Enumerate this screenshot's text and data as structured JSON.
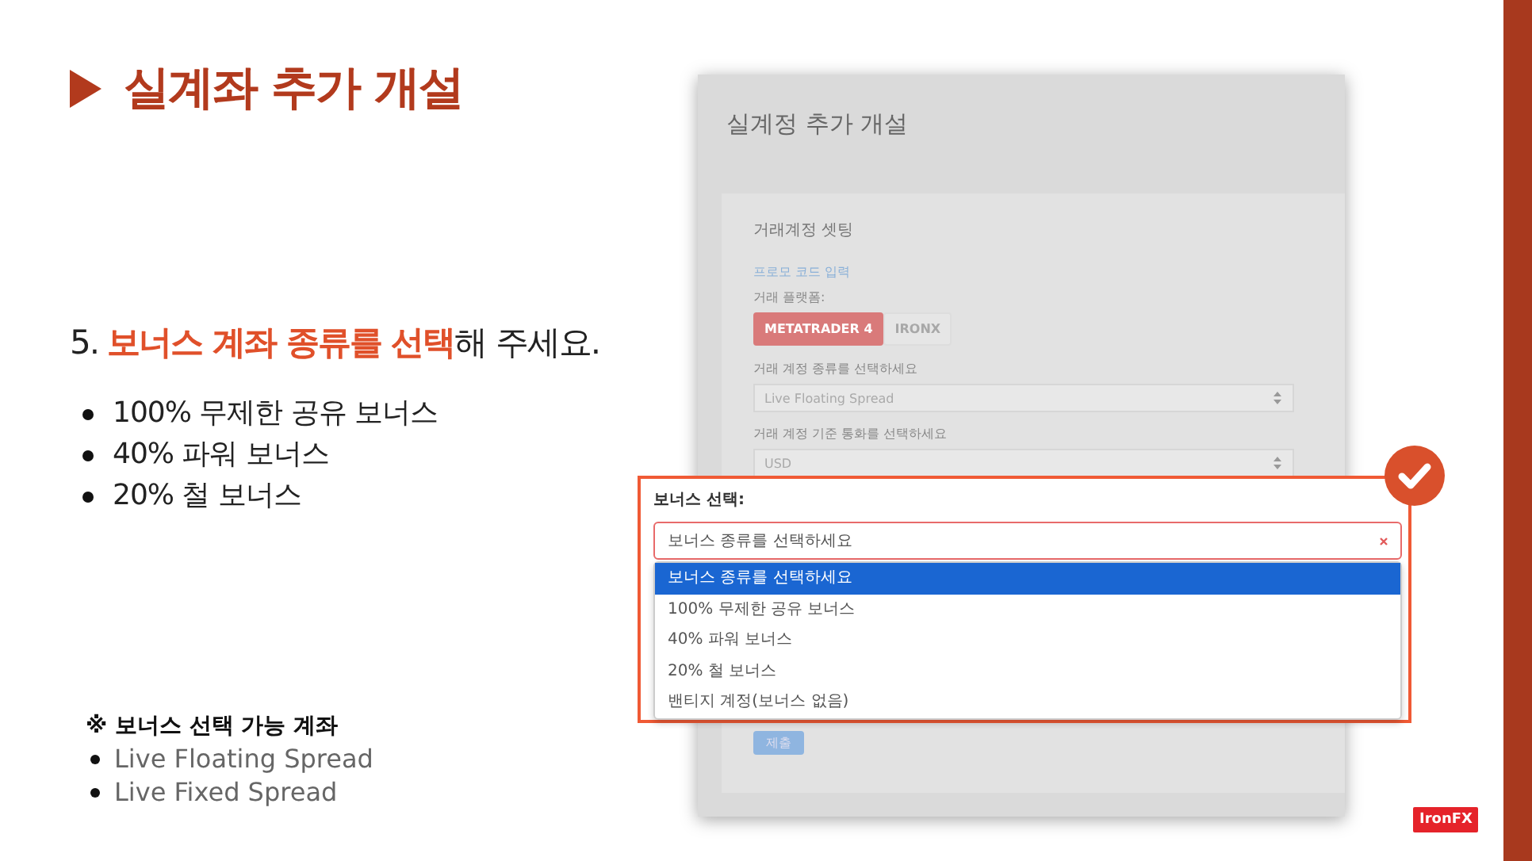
{
  "slide": {
    "title": "실계좌 추가 개설",
    "step": [
      {
        "text": "5. ",
        "highlight": false
      },
      {
        "text": "보너스 계좌 종류를 선택",
        "highlight": true
      },
      {
        "text": "해 주세요.",
        "highlight": false
      }
    ],
    "bonuses": [
      "100% 무제한 공유 보너스",
      "40% 파워 보너스",
      "20% 철 보너스"
    ],
    "note_title": "※ 보너스 선택 가능 계좌",
    "accounts": [
      "Live Floating Spread",
      "Live Fixed Spread"
    ],
    "logo": "IronFX"
  },
  "form": {
    "title": "실계정 추가 개설",
    "section": "거래계정 셋팅",
    "promo_link": "프로모 코드 입력",
    "platform_label": "거래 플랫폼:",
    "platforms": [
      {
        "label": "METATRADER 4",
        "selected": true
      },
      {
        "label": "IRONX",
        "selected": false
      }
    ],
    "account_type_label": "거래 계정 종류를 선택하세요",
    "account_type_value": "Live Floating Spread",
    "currency_label": "거래 계정 기준 통화를 선택하세요",
    "currency_value": "USD",
    "bonus_label": "보너스 선택:",
    "bonus_placeholder": "보너스 종류를 선택하세요",
    "bonus_options": [
      {
        "label": "보너스 종류를 선택하세요",
        "selected": true
      },
      {
        "label": "100% 무제한 공유 보너스",
        "selected": false
      },
      {
        "label": "40% 파워 보너스",
        "selected": false
      },
      {
        "label": "20% 철 보너스",
        "selected": false
      },
      {
        "label": "밴티지 계정(보너스 없음)",
        "selected": false
      }
    ],
    "submit": "제출"
  }
}
